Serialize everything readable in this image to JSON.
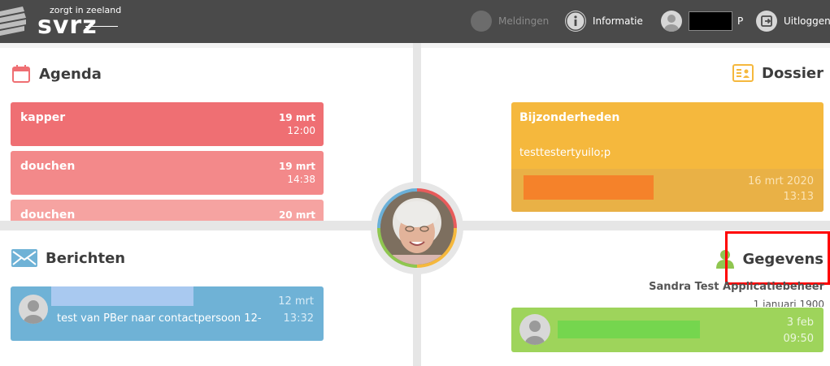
{
  "header": {
    "tagline": "zorgt in zeeland",
    "brand": "svrz",
    "nav": {
      "meldingen": "Meldingen",
      "informatie": "Informatie",
      "user_suffix": "P",
      "uitloggen": "Uitloggen"
    }
  },
  "agenda": {
    "title": "Agenda",
    "items": [
      {
        "title": "kapper",
        "date": "19 mrt",
        "time": "12:00",
        "color": "#ef6f73"
      },
      {
        "title": "douchen",
        "date": "19 mrt",
        "time": "14:38",
        "color": "#f3898a"
      },
      {
        "title": "douchen",
        "date": "20 mrt",
        "time": "",
        "color": "#f6a3a1"
      }
    ]
  },
  "dossier": {
    "title": "Dossier",
    "card": {
      "title": "Bijzonderheden",
      "body": "testtestertyuilo;p",
      "date": "16 mrt 2020",
      "time": "13:13"
    }
  },
  "berichten": {
    "title": "Berichten",
    "message": {
      "date": "12 mrt",
      "text": "test van PBer naar contactpersoon 12-",
      "time": "13:32"
    }
  },
  "gegevens": {
    "title": "Gegevens",
    "person_name": "Sandra Test Applicatiebeheer",
    "dob": "1 januari 1900",
    "card": {
      "date": "3 feb",
      "time": "09:50"
    }
  },
  "colors": {
    "topbar": "#4a4a4a",
    "agenda_accent": "#ef6f73",
    "dossier_accent": "#f5b83d",
    "berichten_accent": "#6fb2d6",
    "gegevens_accent": "#9ed45b",
    "highlight": "#ff0000"
  }
}
